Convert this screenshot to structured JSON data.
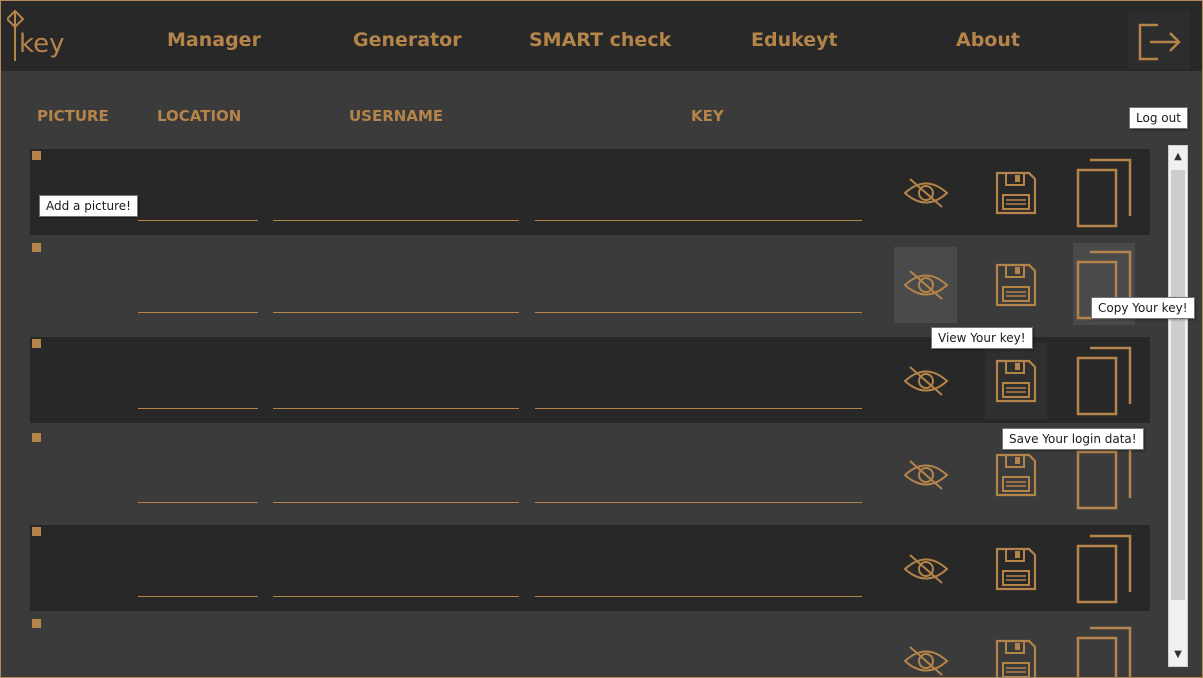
{
  "app": {
    "logo_text": "key"
  },
  "nav": {
    "items": [
      "Manager",
      "Generator",
      "SMART check",
      "Edukeyt",
      "About"
    ]
  },
  "columns": [
    "PICTURE",
    "LOCATION",
    "USERNAME",
    "KEY"
  ],
  "rows": [
    {
      "location": "",
      "username": "",
      "key": ""
    },
    {
      "location": "",
      "username": "",
      "key": ""
    },
    {
      "location": "",
      "username": "",
      "key": ""
    },
    {
      "location": "",
      "username": "",
      "key": ""
    },
    {
      "location": "",
      "username": "",
      "key": ""
    },
    {
      "location": "",
      "username": "",
      "key": ""
    }
  ],
  "tooltips": {
    "logout": "Log out",
    "add_picture": "Add a picture!",
    "copy_key": "Copy Your key!",
    "view_key": "View Your key!",
    "save_login": "Save Your login data!"
  },
  "colors": {
    "accent": "#b5844a",
    "row_dark": "#282828",
    "row_light": "#3b3b3b",
    "nav_bg": "#282828"
  },
  "icons": [
    "logout-icon",
    "hide-key-icon",
    "save-icon",
    "copy-icon",
    "scroll-up-icon",
    "scroll-down-icon"
  ]
}
